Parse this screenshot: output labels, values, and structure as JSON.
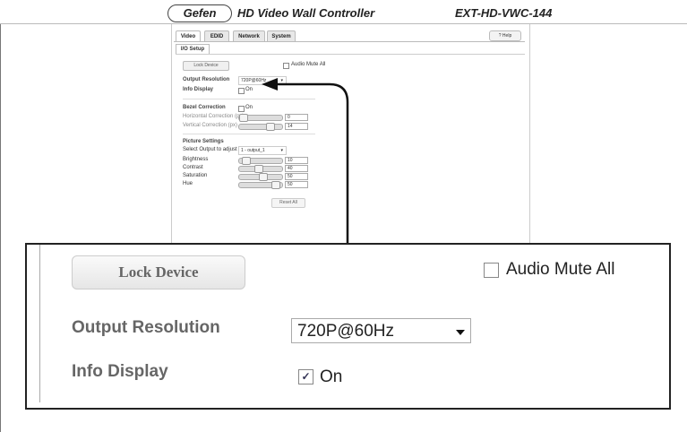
{
  "header": {
    "logo": "Gefen",
    "app_title": "HD Video Wall Controller",
    "model": "EXT-HD-VWC-144"
  },
  "tabs": [
    "Video",
    "EDID",
    "Network",
    "System"
  ],
  "help_label": "? Help",
  "subtab": "I/O Setup",
  "io_setup": {
    "lock_device": "Lock Device",
    "audio_mute_all": "Audio Mute All",
    "output_resolution_label": "Output Resolution",
    "output_resolution_value": "720P@60Hz",
    "info_display_label": "Info Display",
    "info_display_option": "On",
    "info_display_checked": true
  },
  "bezel": {
    "title": "Bezel Correction",
    "option": "On",
    "horizontal_label": "Horizontal Correction (px)",
    "horizontal_value": "0",
    "vertical_label": "Vertical Correction (px)",
    "vertical_value": "14"
  },
  "picture": {
    "title": "Picture Settings",
    "select_label": "Select Output to adjust",
    "select_value": "1 - output_1",
    "brightness_label": "Brightness",
    "brightness_value": "10",
    "contrast_label": "Contrast",
    "contrast_value": "40",
    "saturation_label": "Saturation",
    "saturation_value": "50",
    "hue_label": "Hue",
    "hue_value": "50",
    "reset_label": "Reset All"
  },
  "accent_color": "#335588"
}
